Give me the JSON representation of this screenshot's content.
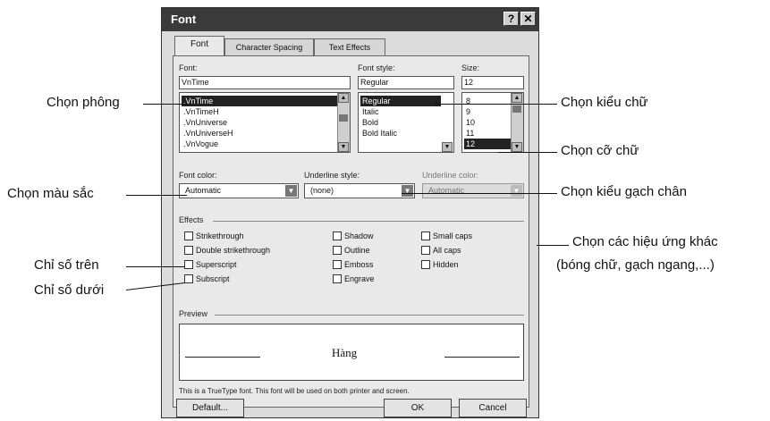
{
  "dialog": {
    "title": "Font",
    "help_label": "?",
    "close_label": "✕",
    "tabs": [
      {
        "label": "Font",
        "active": true
      },
      {
        "label": "Character Spacing",
        "active": false
      },
      {
        "label": "Text Effects",
        "active": false
      }
    ],
    "font": {
      "label": "Font:",
      "value": "VnTime",
      "items": [
        ".VnTime",
        ".VnTimeH",
        ".VnUniverse",
        ".VnUniverseH",
        ".VnVogue"
      ],
      "selected_index": 0
    },
    "font_style": {
      "label": "Font style:",
      "value": "Regular",
      "items": [
        "Regular",
        "Italic",
        "Bold",
        "Bold Italic"
      ],
      "selected_index": 0
    },
    "size": {
      "label": "Size:",
      "value": "12",
      "items": [
        "8",
        "9",
        "10",
        "11",
        "12"
      ],
      "selected_index": 4
    },
    "font_color": {
      "label": "Font color:",
      "value": "Automatic"
    },
    "underline_style": {
      "label": "Underline style:",
      "value": "(none)"
    },
    "underline_color": {
      "label": "Underline color:",
      "value": "Automatic"
    },
    "effects": {
      "label": "Effects",
      "col1": [
        "Strikethrough",
        "Double strikethrough",
        "Superscript",
        "Subscript"
      ],
      "col2": [
        "Shadow",
        "Outline",
        "Emboss",
        "Engrave"
      ],
      "col3": [
        "Small caps",
        "All caps",
        "Hidden"
      ]
    },
    "preview": {
      "label": "Preview",
      "sample": "Hàng"
    },
    "info_text": "This is a TrueType font. This font will be used on both printer and screen.",
    "buttons": {
      "default": "Default...",
      "ok": "OK",
      "cancel": "Cancel"
    }
  },
  "annotations": {
    "chon_phong": "Chọn phông",
    "chon_mau_sac": "Chọn màu sắc",
    "chi_so_tren": "Chỉ số trên",
    "chi_so_duoi": "Chỉ số dưới",
    "chon_kieu_chu": "Chọn kiểu chữ",
    "chon_co_chu": "Chọn cỡ chữ",
    "chon_kieu_gach_chan": "Chọn kiểu gạch chân",
    "chon_hieu_ung_1": "Chọn các hiệu ứng khác",
    "chon_hieu_ung_2": "(bóng chữ, gạch ngang,...)"
  }
}
